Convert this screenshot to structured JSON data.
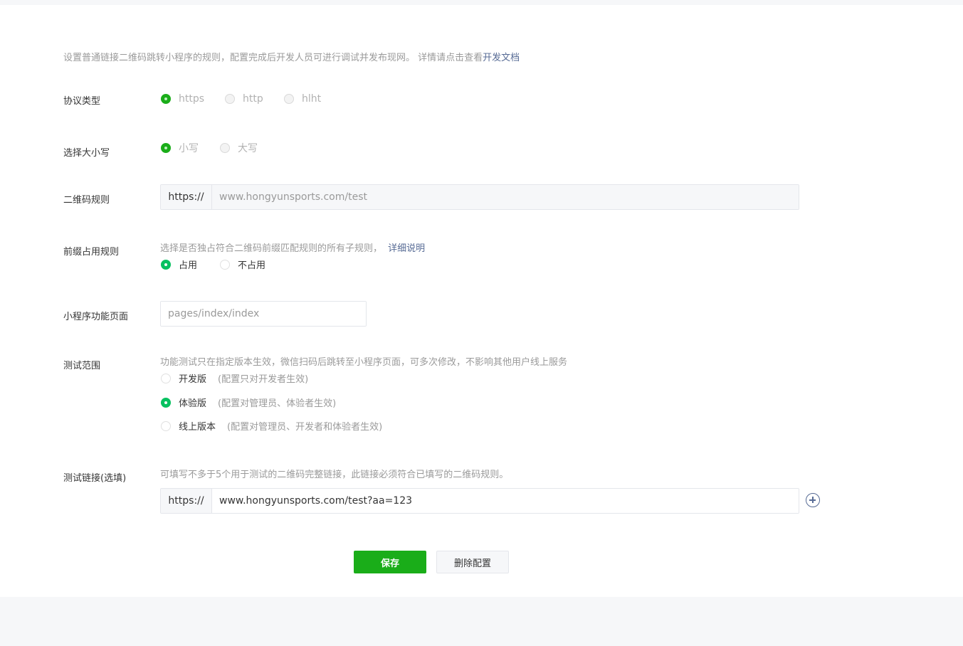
{
  "intro": {
    "text": "设置普通链接二维码跳转小程序的规则，配置完成后开发人员可进行调试并发布现网。 详情请点击查看",
    "link": "开发文档"
  },
  "protocol": {
    "label": "协议类型",
    "options": [
      "https",
      "http",
      "hlht"
    ],
    "selected": "https"
  },
  "case": {
    "label": "选择大小写",
    "options": [
      "小写",
      "大写"
    ],
    "selected": "小写"
  },
  "qr_rule": {
    "label": "二维码规则",
    "prefix": "https://",
    "placeholder": "www.hongyunsports.com/test"
  },
  "prefix_rule": {
    "label": "前缀占用规则",
    "desc": "选择是否独占符合二维码前缀匹配规则的所有子规则，",
    "link": "详细说明",
    "options": [
      "占用",
      "不占用"
    ],
    "selected": "占用"
  },
  "page": {
    "label": "小程序功能页面",
    "placeholder": "pages/index/index"
  },
  "test_scope": {
    "label": "测试范围",
    "desc": "功能测试只在指定版本生效，微信扫码后跳转至小程序页面，可多次修改，不影响其他用户线上服务",
    "options": [
      {
        "label": "开发版",
        "note": "(配置只对开发者生效)"
      },
      {
        "label": "体验版",
        "note": "(配置对管理员、体验者生效)"
      },
      {
        "label": "线上版本",
        "note": "(配置对管理员、开发者和体验者生效)"
      }
    ],
    "selected": "体验版"
  },
  "test_link": {
    "label": "测试链接(选填)",
    "desc": "可填写不多于5个用于测试的二维码完整链接，此链接必须符合已填写的二维码规则。",
    "prefix": "https://",
    "value": "www.hongyunsports.com/test?aa=123",
    "add_icon": "plus-circle-icon"
  },
  "actions": {
    "save": "保存",
    "delete": "删除配置"
  },
  "colors": {
    "accent": "#1aad19",
    "link": "#576b95",
    "page_bg": "#f6f7f9"
  }
}
